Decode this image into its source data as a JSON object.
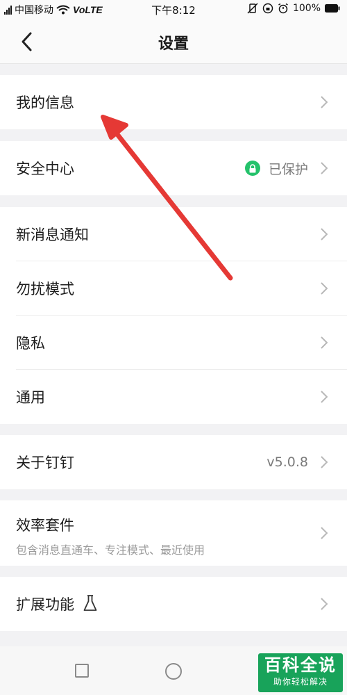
{
  "status_bar": {
    "carrier": "中国移动",
    "network": "VoLTE",
    "time": "下午8:12",
    "battery": "100%"
  },
  "header": {
    "title": "设置",
    "back_icon": "chevron-left-icon"
  },
  "groups": [
    {
      "items": [
        {
          "label": "我的信息"
        }
      ]
    },
    {
      "items": [
        {
          "label": "安全中心",
          "status": "已保护",
          "status_icon": "lock-icon"
        }
      ]
    },
    {
      "items": [
        {
          "label": "新消息通知"
        },
        {
          "label": "勿扰模式"
        },
        {
          "label": "隐私"
        },
        {
          "label": "通用"
        }
      ]
    },
    {
      "items": [
        {
          "label": "关于钉钉",
          "value": "v5.0.8"
        }
      ]
    },
    {
      "items": [
        {
          "label": "效率套件",
          "sublabel": "包含消息直通车、专注模式、最近使用"
        }
      ]
    },
    {
      "items": [
        {
          "label": "扩展功能",
          "icon": "flask-icon"
        }
      ]
    }
  ],
  "watermark": {
    "title": "百科全说",
    "subtitle": "助你轻松解决"
  },
  "colors": {
    "background": "#f2f2f4",
    "accent_green": "#24c26b",
    "annotation_arrow": "#e53935",
    "watermark_green": "#18a35a"
  }
}
